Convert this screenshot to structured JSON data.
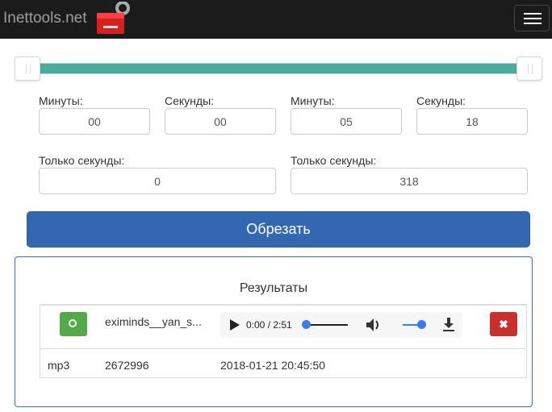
{
  "nav": {
    "brand": "Inettools.net"
  },
  "slider": {
    "start_fraction": 0,
    "end_fraction": 1,
    "color": "#48ad9e"
  },
  "start": {
    "minutes_label": "Минуты:",
    "minutes": "00",
    "seconds_label": "Секунды:",
    "seconds": "00",
    "only_seconds_label": "Только секунды:",
    "only_seconds": "0"
  },
  "end": {
    "minutes_label": "Минуты:",
    "minutes": "05",
    "seconds_label": "Секунды:",
    "seconds": "18",
    "only_seconds_label": "Только секунды:",
    "only_seconds": "318"
  },
  "cut_label": "Обрезать",
  "results": {
    "title": "Результаты",
    "file": {
      "name": "eximinds__yan_s...",
      "time": "0:00 / 2:51",
      "format": "mp3",
      "size": "2672996",
      "date": "2018-01-21 20:45:50",
      "delete_glyph": "✖"
    }
  }
}
